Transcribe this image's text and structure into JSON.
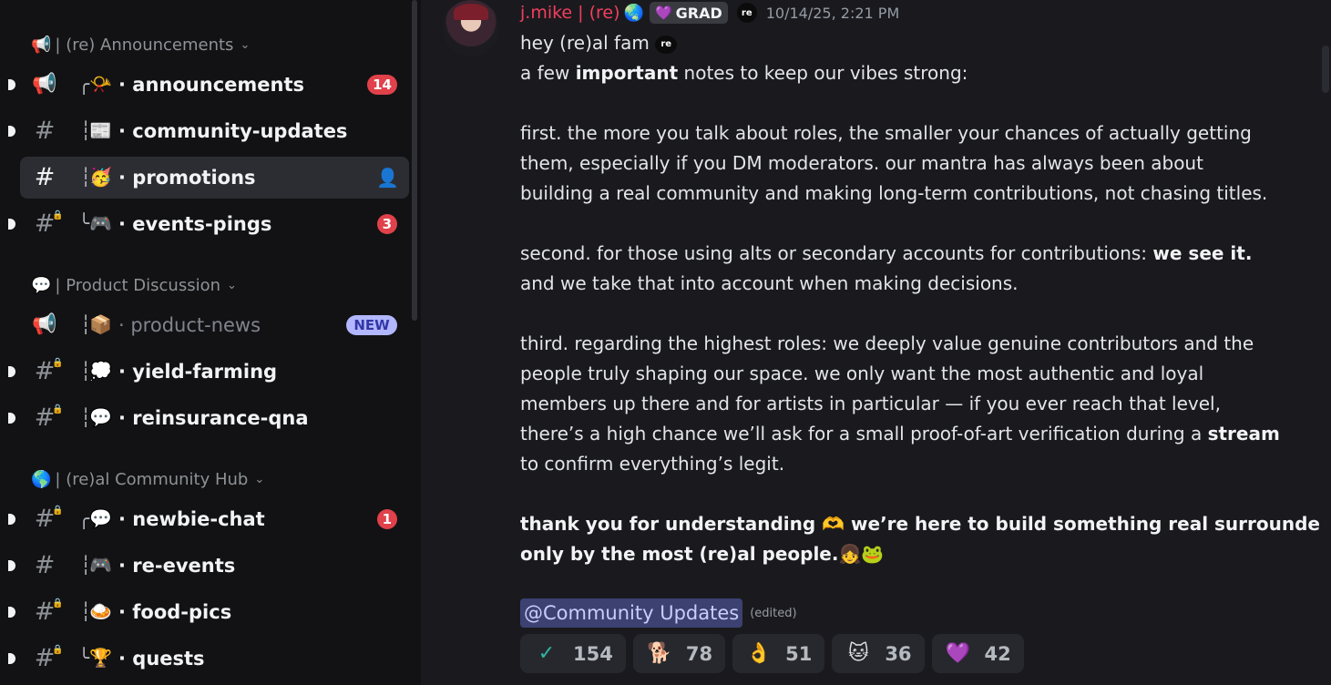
{
  "sidebar": {
    "categories": [
      {
        "emoji": "📢",
        "label": "| (re) Announcements"
      },
      {
        "emoji": "💬",
        "label": "| Product Discussion"
      },
      {
        "emoji": "🌎",
        "label": "| (re)al Community Hub"
      }
    ],
    "channels": [
      {
        "tree": "╭",
        "emoji": "📯",
        "name": "· announcements",
        "badge": "14"
      },
      {
        "tree": "┆",
        "emoji": "📰",
        "name": "· community-updates"
      },
      {
        "tree": "┆",
        "emoji": "🥳",
        "name": "· promotions"
      },
      {
        "tree": "╰",
        "emoji": "🎮",
        "name": "· events-pings",
        "badge": "3"
      },
      {
        "tree": "┆",
        "emoji": "📦",
        "name": "· product-news",
        "badge": "NEW"
      },
      {
        "tree": "┆",
        "emoji": "💭",
        "name": "· yield-farming"
      },
      {
        "tree": "┆",
        "emoji": "💬",
        "name": "· reinsurance-qna"
      },
      {
        "tree": "╭",
        "emoji": "💬",
        "name": "· newbie-chat",
        "badge": "1"
      },
      {
        "tree": "┆",
        "emoji": "🎮",
        "name": "· re-events"
      },
      {
        "tree": "┆",
        "emoji": "🍛",
        "name": "· food-pics"
      },
      {
        "tree": "╰",
        "emoji": "🏆",
        "name": "· quests"
      }
    ]
  },
  "message": {
    "username": "j.mike | (re)",
    "username_color": "#f23f5e",
    "globe_emoji": "🌏",
    "tag": "GRAD",
    "tag_icon": "💜",
    "server_badge": "re",
    "timestamp": "10/14/25, 2:21 PM",
    "lines": {
      "l1": "hey (re)al fam",
      "l2_pre": "a few ",
      "l2_bold": "important",
      "l2_post": " notes to keep our vibes strong:",
      "p1_1": "first. the more you talk about roles, the smaller your chances of actually getting",
      "p1_2": "them, especially if you DM moderators. our mantra has always been about",
      "p1_3": "building a real community and making long-term contributions, not chasing titles.",
      "p2_1_pre": "second. for those using alts or secondary accounts for contributions: ",
      "p2_1_bold": "we see it.",
      "p2_2": "and we take that into account when making decisions.",
      "p3_1": "third. regarding the highest roles: we deeply value genuine contributors and the",
      "p3_2": "people truly shaping our space. we only want the most authentic and loyal",
      "p3_3": "members up there and for artists in particular — if you ever reach that level,",
      "p3_4_pre": "there’s a high chance we’ll ask for a small proof-of-art verification during a ",
      "p3_4_bold": "stream",
      "p3_5": "to confirm everything’s legit.",
      "p4_1_a": "thank you for understanding ",
      "p4_1_emoji": "🫶",
      "p4_1_b": " we’re here to build something real surrounded",
      "p4_2": "only by the most (re)al people.",
      "p4_2_emojis": "👧🐸"
    },
    "mention": "@Community Updates",
    "edited": "(edited)",
    "reactions": [
      {
        "emoji": "✓",
        "count": "154"
      },
      {
        "emoji": "🐕",
        "count": "78"
      },
      {
        "emoji": "👌",
        "count": "51"
      },
      {
        "emoji": "🐱",
        "count": "36"
      },
      {
        "emoji": "💜",
        "count": "42"
      }
    ]
  }
}
